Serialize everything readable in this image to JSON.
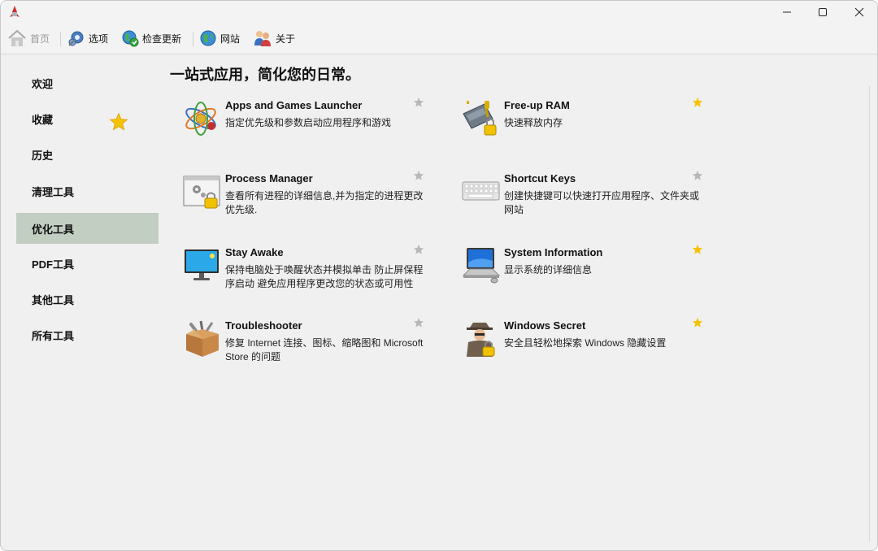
{
  "toolbar": {
    "home": "首页",
    "options": "选项",
    "check_update": "检查更新",
    "website": "网站",
    "about": "关于"
  },
  "sidebar": {
    "items": [
      {
        "label": "欢迎"
      },
      {
        "label": "收藏"
      },
      {
        "label": "历史"
      },
      {
        "label": "清理工具"
      },
      {
        "label": "优化工具",
        "active": true
      },
      {
        "label": "PDF工具"
      },
      {
        "label": "其他工具"
      },
      {
        "label": "所有工具"
      }
    ]
  },
  "main": {
    "title": "一站式应用，简化您的日常。",
    "tools": [
      {
        "title": "Apps and Games Launcher",
        "desc": "指定优先级和参数启动应用程序和游戏",
        "favorite": false,
        "icon": "atom-icon"
      },
      {
        "title": "Free-up RAM",
        "desc": "快速释放内存",
        "favorite": true,
        "icon": "ram-chip-icon"
      },
      {
        "title": "Process Manager",
        "desc": "查看所有进程的详细信息,并为指定的进程更改优先级.",
        "favorite": false,
        "icon": "process-window-icon"
      },
      {
        "title": "Shortcut Keys",
        "desc": "创建快捷键可以快速打开应用程序、文件夹或网站",
        "favorite": false,
        "icon": "keyboard-icon"
      },
      {
        "title": "Stay Awake",
        "desc": "保持电脑处于唤醒状态并模拟单击 防止屏保程序启动 避免应用程序更改您的状态或可用性",
        "favorite": false,
        "icon": "monitor-icon"
      },
      {
        "title": "System Information",
        "desc": "显示系统的详细信息",
        "favorite": true,
        "icon": "computer-icon"
      },
      {
        "title": "Troubleshooter",
        "desc": "修复 Internet 连接、图标、缩略图和 Microsoft Store 的问题",
        "favorite": false,
        "icon": "toolbox-icon"
      },
      {
        "title": "Windows Secret",
        "desc": "安全且轻松地探索 Windows 隐藏设置",
        "favorite": true,
        "icon": "detective-icon"
      }
    ]
  },
  "colors": {
    "active_bg": "#c3cec2",
    "star_on": "#f6c200",
    "star_off": "#b8b8b8"
  }
}
